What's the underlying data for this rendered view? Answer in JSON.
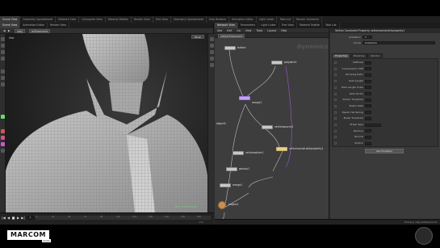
{
  "desktop_tabs": [
    "Scene View",
    "Geometry Spreadsheet",
    "Network View",
    "Composite View",
    "Material Palette",
    "Render View",
    "Tree View",
    "Geometry Spreadsheet",
    "Help Browser",
    "Animation Editor",
    "Light Linker",
    "Take List",
    "Render Scheduler"
  ],
  "viewport": {
    "tabs": [
      "Scene View",
      "Animation Editor",
      "Render View"
    ],
    "path": "/obj/",
    "node": "wrEasecoord",
    "label": "Geo",
    "camera": "Persp",
    "corner_tag": "Non-Commercial"
  },
  "timeline": {
    "frame": "1",
    "buttons": [
      "|◀",
      "◀",
      "■",
      "▶",
      "▶|"
    ],
    "ticks": [
      "0",
      "24",
      "48",
      "72",
      "96",
      "120",
      "144",
      "168",
      "192",
      "216",
      "240"
    ],
    "end": "240"
  },
  "right_tabs": [
    "Network View",
    "Parameters",
    "Light Linker",
    "Tree View",
    "Material Palette",
    "Take List"
  ],
  "network": {
    "menu": [
      "Add",
      "Edit",
      "Go",
      "View",
      "Tools",
      "Layout",
      "Help"
    ],
    "path": "/obj/wrEasecoord",
    "watermark": "Dynamics",
    "nodes": [
      {
        "label": "button"
      },
      {
        "label": "polywire1"
      },
      {
        "label": "merge1"
      },
      {
        "label": "object1"
      },
      {
        "label": "vellumsource1"
      },
      {
        "label": "vellumconstraintproperty1"
      },
      {
        "label": "vellumsolver1"
      },
      {
        "label": "grouby1"
      },
      {
        "label": "merge1"
      },
      {
        "label": "output1"
      }
    ]
  },
  "params": {
    "header": "Vellum Constraint Property  vellumconstraintproperty1",
    "rows": [
      {
        "label": "Activation",
        "value": "1"
      },
      {
        "label": "Group",
        "value": "breakwire"
      }
    ],
    "tabs": [
      "Properties",
      "Breaking",
      "Render"
    ],
    "list": [
      "Stiffness",
      "Compression Stiff",
      "Damping Ratio",
      "Rest Length",
      "Rest Length Scale",
      "Rest Vector",
      "Plastic Threshold",
      "Plastic Rate",
      "Plastic Hardening",
      "Break Threshold",
      "Break Type",
      "Remove",
      "Normal",
      "Stretch"
    ],
    "button": "Use Multiplier"
  },
  "status": "Primary: /obj/ wrEasecoord",
  "overlay": {
    "logo": "MARCOM",
    "logo_sub": "studio"
  }
}
